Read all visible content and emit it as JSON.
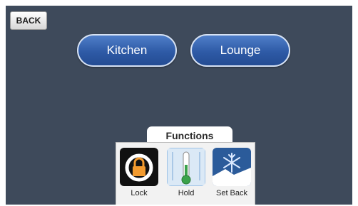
{
  "header": {
    "back_label": "BACK"
  },
  "rooms": [
    {
      "label": "Kitchen"
    },
    {
      "label": "Lounge"
    }
  ],
  "functions": {
    "title": "Functions",
    "items": [
      {
        "label": "Lock",
        "icon": "padlock-icon"
      },
      {
        "label": "Hold",
        "icon": "thermometer-icon"
      },
      {
        "label": "Set Back",
        "icon": "snowflake-icon"
      }
    ]
  },
  "colors": {
    "background": "#3e4a5b",
    "room_button": "#2e5aa6",
    "lock_accent": "#f29a2e"
  }
}
